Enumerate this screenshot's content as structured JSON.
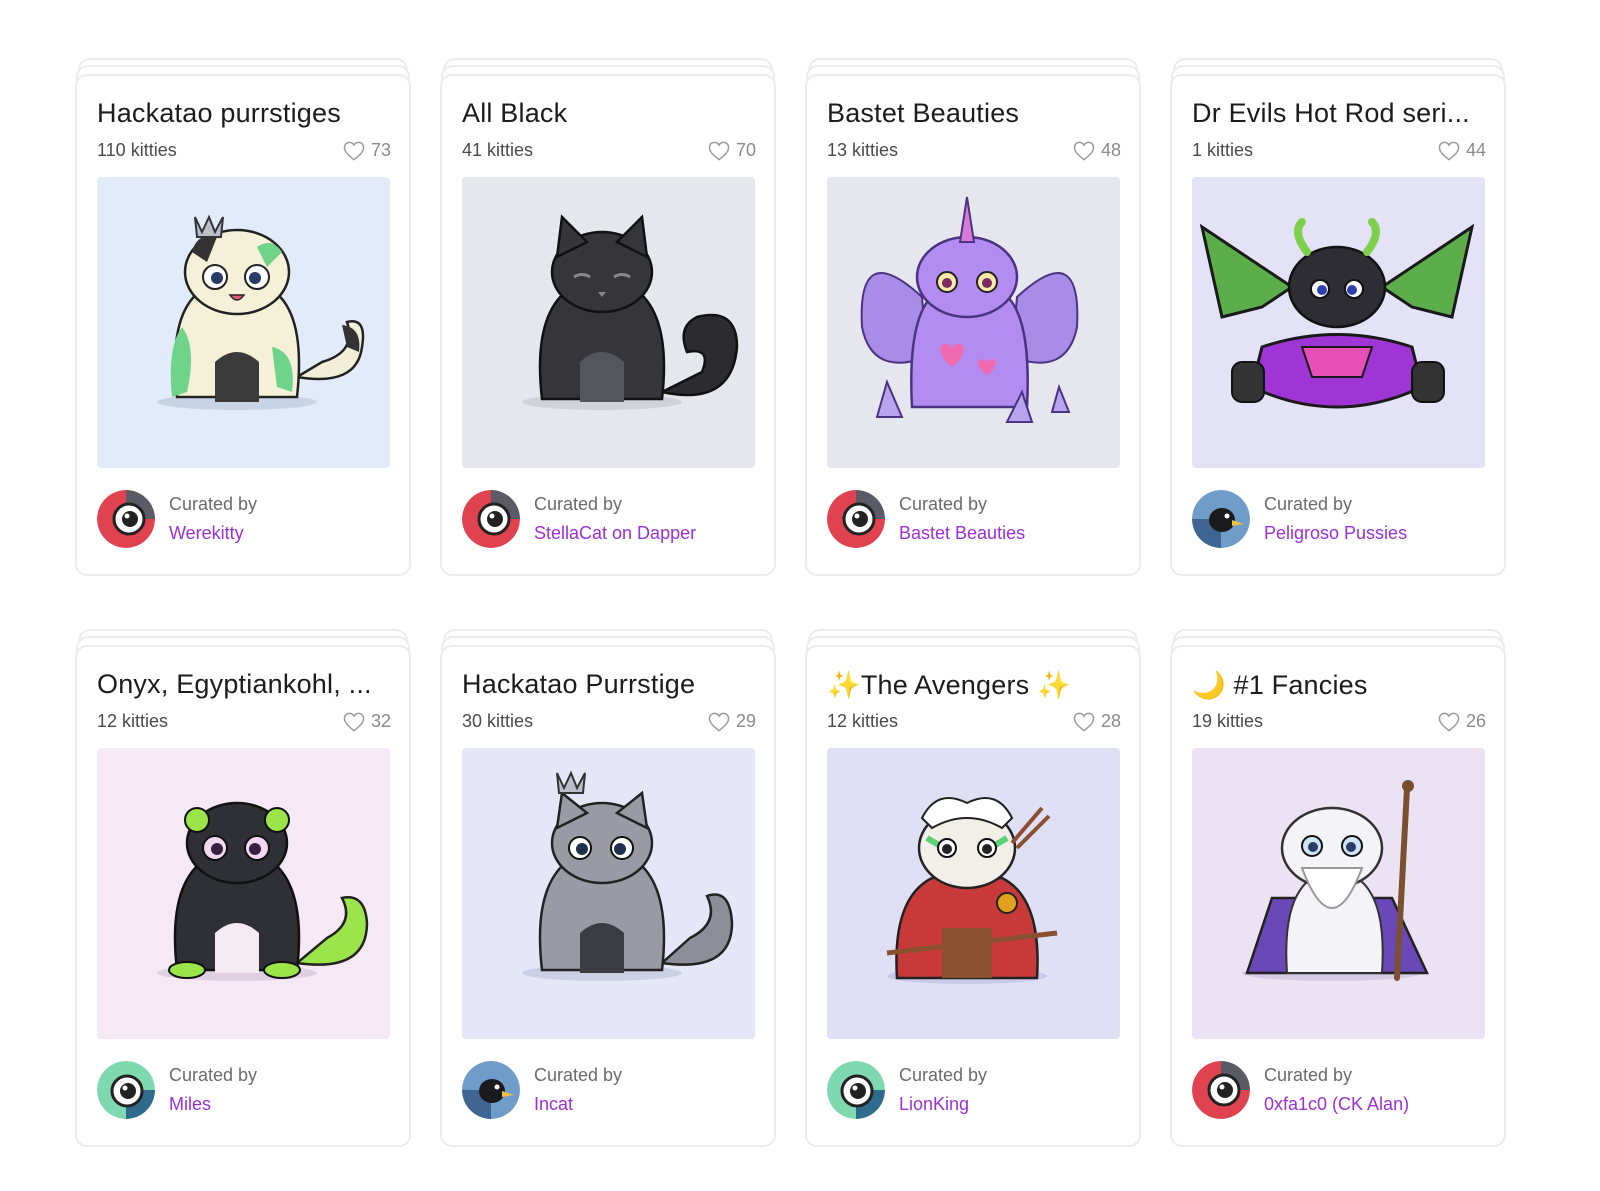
{
  "labels": {
    "curated_by": "Curated by"
  },
  "cards": [
    {
      "title": "Hackatao purrstiges",
      "count": "110 kitties",
      "likes": "73",
      "curator": "Werekitty",
      "art_bg": "#e2ebf9",
      "art_icon": "cat-crown-green-icon",
      "avatar": "red-eye-avatar"
    },
    {
      "title": "All Black",
      "count": "41 kitties",
      "likes": "70",
      "curator": "StellaCat on Dapper",
      "art_bg": "#e5e7ec",
      "art_icon": "cat-black-icon",
      "avatar": "red-eye-avatar"
    },
    {
      "title": "Bastet Beauties",
      "count": "13 kitties",
      "likes": "48",
      "curator": "Bastet Beauties",
      "art_bg": "#e6e6ee",
      "art_icon": "cat-unicorn-wings-icon",
      "avatar": "red-eye-avatar"
    },
    {
      "title": "Dr Evils Hot Rod seri...",
      "count": "1 kitties",
      "likes": "44",
      "curator": "Peligroso Pussies",
      "art_bg": "#e3e2f7",
      "art_icon": "cat-dragon-kart-icon",
      "avatar": "blue-bird-avatar"
    },
    {
      "title": "Onyx, Egyptiankohl, ...",
      "count": "12 kitties",
      "likes": "32",
      "curator": "Miles",
      "art_bg": "#f6e9f6",
      "art_icon": "cat-black-green-icon",
      "avatar": "green-eye-avatar"
    },
    {
      "title": "Hackatao Purrstige",
      "count": "30 kitties",
      "likes": "29",
      "curator": "Incat",
      "art_bg": "#e5e7f8",
      "art_icon": "cat-crown-grey-icon",
      "avatar": "blue-bird-avatar"
    },
    {
      "title": "✨The Avengers ✨",
      "count": "12 kitties",
      "likes": "28",
      "curator": "LionKing",
      "art_bg": "#dfdff6",
      "art_icon": "cat-archer-icon",
      "avatar": "green-eye-avatar"
    },
    {
      "title": "🌙 #1 Fancies",
      "count": "19 kitties",
      "likes": "26",
      "curator": "0xfa1c0 (CK Alan)",
      "art_bg": "#ebe2f3",
      "art_icon": "cat-wizard-icon",
      "avatar": "red-eye-avatar"
    }
  ]
}
